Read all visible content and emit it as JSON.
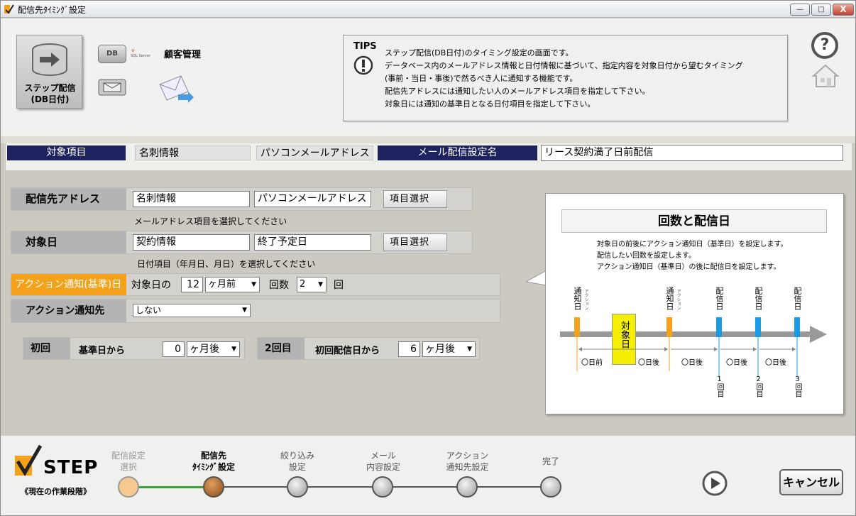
{
  "window": {
    "title": "配信先ﾀｲﾐﾝｸﾞ設定",
    "minimize": "—",
    "restore": "□",
    "close": "X"
  },
  "sidebar": {
    "step_button": {
      "line1": "ステップ配信",
      "line2": "(DB日付)"
    },
    "db_label": "DB",
    "sqlserver_label": "SQL Server",
    "customer_label": "顧客管理"
  },
  "tips": {
    "title": "TIPS",
    "lines": [
      "ステップ配信(DB日付)のタイミング設定の画面です。",
      "データベース内のメールアドレス情報と日付情報に基づいて、指定内容を対象日付から望むタイミング",
      "(事前・当日・事後)で然るべき人に通知する機能です。",
      "配信先アドレスには通知したい人のメールアドレス項目を指定して下さい。",
      "対象日には通知の基準日となる日付項目を指定して下さい。"
    ]
  },
  "header_row": {
    "target_label": "対象項目",
    "target_table": "名刺情報",
    "target_field": "パソコンメールアドレス",
    "mail_setting_label": "メール配信設定名",
    "mail_setting_value": "リース契約満了日前配信"
  },
  "form": {
    "address": {
      "label": "配信先アドレス",
      "table": "名刺情報",
      "field": "パソコンメールアドレス",
      "button": "項目選択",
      "hint": "メールアドレス項目を選択してください"
    },
    "target_date": {
      "label": "対象日",
      "table": "契約情報",
      "field": "終了予定日",
      "button": "項目選択",
      "hint": "日付項目（年月日、月日）を選択してください"
    },
    "action": {
      "label": "アクション通知(基準)日",
      "prefix": "対象日の",
      "value": "12",
      "unit_select": "ヶ月前",
      "count_label": "回数",
      "count_value": "2",
      "count_unit": "回"
    },
    "notify": {
      "label": "アクション通知先",
      "value": "しない"
    },
    "first": {
      "label": "初回",
      "base_label": "基準日から",
      "value": "0",
      "unit": "ヶ月後"
    },
    "second": {
      "label": "2回目",
      "base_label": "初回配信日から",
      "value": "6",
      "unit": "ヶ月後"
    }
  },
  "panel": {
    "title": "回数と配信日",
    "lines": [
      "対象日の前後にアクション通知日（基準日）を設定します。",
      "配信したい回数を設定します。",
      "アクション通知日（基準日）の後に配信日を設定します。"
    ],
    "notify_label": "通知日",
    "action_small": "アクション",
    "target_label": "対象日",
    "delivery_label": "配信日",
    "before": "〇日前",
    "after": "〇日後",
    "n1": "1回目",
    "n2": "2回目",
    "n3": "3回目"
  },
  "steps": {
    "logo": "STEP",
    "current_phase": "《現在の作業段階》",
    "items": [
      {
        "l1": "配信設定",
        "l2": "選択"
      },
      {
        "l1": "配信先",
        "l2": "ﾀｲﾐﾝｸﾞ設定"
      },
      {
        "l1": "絞り込み",
        "l2": "設定"
      },
      {
        "l1": "メール",
        "l2": "内容設定"
      },
      {
        "l1": "アクション",
        "l2": "通知先設定"
      },
      {
        "l1": "完了",
        "l2": ""
      }
    ]
  },
  "buttons": {
    "cancel": "キャンセル",
    "help": "?"
  },
  "colors": {
    "navy": "#1e2360",
    "orange": "#f6a11a",
    "blue_marker": "#1a9be6",
    "done_step": "#f5c98f",
    "current_step": "#b26a2a"
  }
}
